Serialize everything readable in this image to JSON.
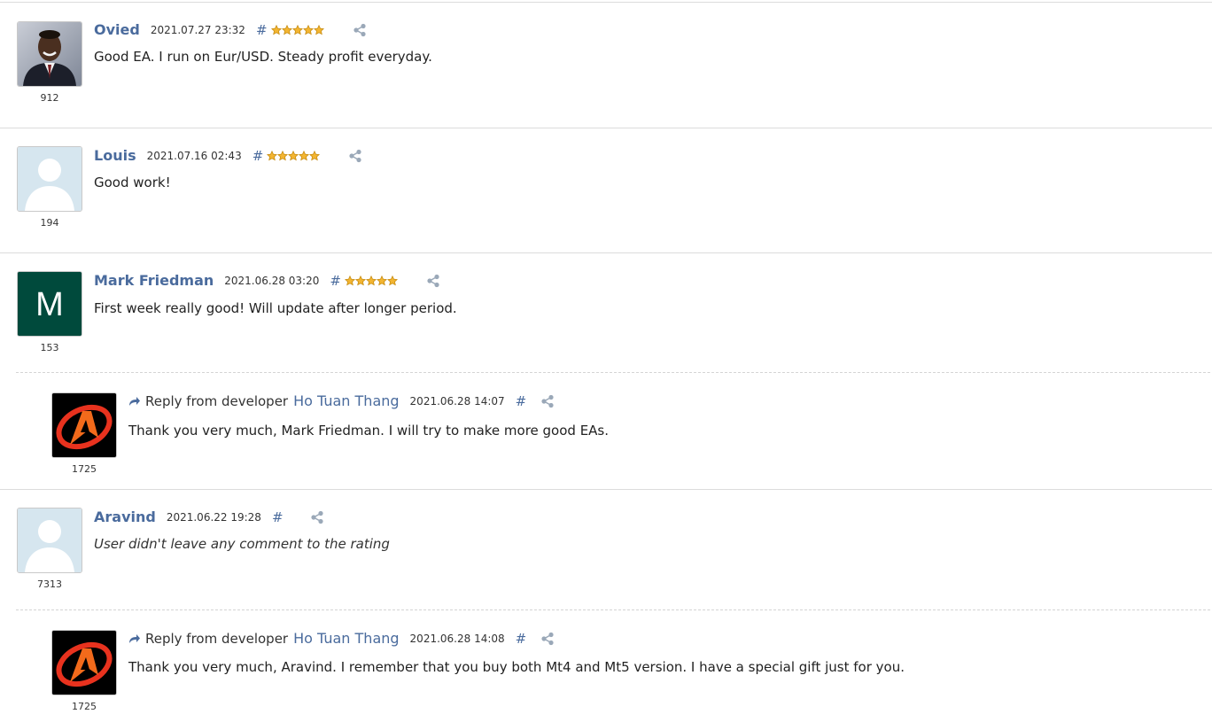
{
  "colors": {
    "link": "#4a6b9d",
    "star_fill": "#f3b531",
    "star_stroke": "#c48a10",
    "separator": "#dcdcdc",
    "avatar_placeholder_bg": "#d6e6ef",
    "avatar_m_bg": "#004a3c"
  },
  "reviews": [
    {
      "author": "Ovied",
      "date": "2021.07.27 23:32",
      "hash": "#",
      "stars": 5,
      "rating": "912",
      "text": "Good EA. I run on Eur/USD. Steady profit everyday.",
      "avatar": "photo-avatar"
    },
    {
      "author": "Louis",
      "date": "2021.07.16 02:43",
      "hash": "#",
      "stars": 5,
      "rating": "194",
      "text": "Good work!",
      "avatar": "placeholder-avatar"
    },
    {
      "author": "Mark Friedman",
      "date": "2021.06.28 03:20",
      "hash": "#",
      "stars": 5,
      "rating": "153",
      "text": "First week really good! Will update after longer period.",
      "avatar": "letter-avatar",
      "avatar_letter": "M",
      "reply": {
        "prefix": "Reply from developer",
        "developer": "Ho Tuan Thang",
        "date": "2021.06.28 14:07",
        "hash": "#",
        "rating": "1725",
        "text": "Thank you very much, Mark Friedman. I will try to make more good EAs."
      }
    },
    {
      "author": "Aravind",
      "date": "2021.06.22 19:28",
      "hash": "#",
      "stars": 0,
      "rating": "7313",
      "text": "User didn't leave any comment to the rating",
      "avatar": "placeholder-avatar",
      "reply": {
        "prefix": "Reply from developer",
        "developer": "Ho Tuan Thang",
        "date": "2021.06.28 14:08",
        "hash": "#",
        "rating": "1725",
        "text": "Thank you very much, Aravind. I remember that you buy both Mt4 and Mt5 version. I have a special gift just for you."
      }
    }
  ]
}
